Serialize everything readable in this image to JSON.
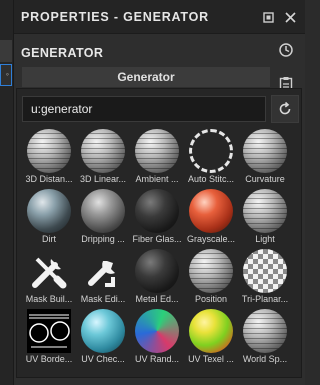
{
  "window": {
    "title": "PROPERTIES - GENERATOR",
    "maximize_icon": "maximize-icon",
    "close_icon": "close-icon"
  },
  "section": {
    "heading": "GENERATOR",
    "button_label": "Generator"
  },
  "side_icons": [
    "history-icon",
    "clipboard-icon"
  ],
  "search": {
    "value": "u:generator",
    "reset_icon": "reset-icon"
  },
  "tiles": [
    {
      "label": "3D Distan...",
      "style": "ring-lines"
    },
    {
      "label": "3D Linear...",
      "style": "ring-lines"
    },
    {
      "label": "Ambient ...",
      "style": "ring-lines"
    },
    {
      "label": "Auto Stitc...",
      "style": "auto-stitch"
    },
    {
      "label": "Curvature",
      "style": "ring-lines"
    },
    {
      "label": "Dirt",
      "style": "s-dirt"
    },
    {
      "label": "Dripping ...",
      "style": "s-drip"
    },
    {
      "label": "Fiber Glas...",
      "style": "s-dark"
    },
    {
      "label": "Grayscale...",
      "style": "s-red"
    },
    {
      "label": "Light",
      "style": "ring-lines"
    },
    {
      "label": "Mask Buil...",
      "style": "tools-icon"
    },
    {
      "label": "Mask Edi...",
      "style": "wrench-icon"
    },
    {
      "label": "Metal Ed...",
      "style": "s-dark"
    },
    {
      "label": "Position",
      "style": "ring-lines"
    },
    {
      "label": "Tri-Planar...",
      "style": "s-checker"
    },
    {
      "label": "UV Borde...",
      "style": "uv-border"
    },
    {
      "label": "UV Chec...",
      "style": "s-cyan"
    },
    {
      "label": "UV Rand...",
      "style": "s-multi"
    },
    {
      "label": "UV Texel ...",
      "style": "s-rainbow"
    },
    {
      "label": "World Sp...",
      "style": "ring-lines"
    }
  ]
}
